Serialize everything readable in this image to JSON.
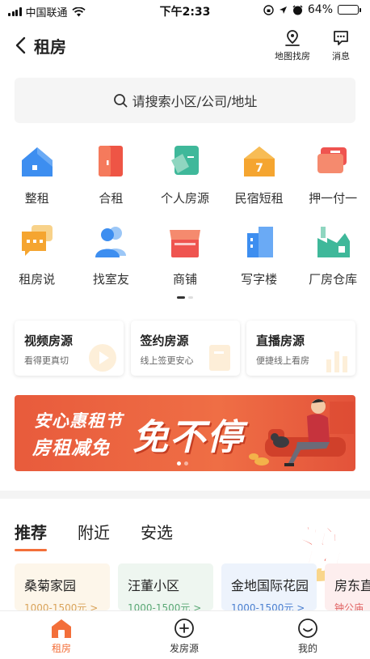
{
  "status_bar": {
    "carrier": "中国联通",
    "time": "下午2:33",
    "battery": "64%",
    "battery_level": 0.64
  },
  "header": {
    "title": "租房",
    "actions": [
      {
        "label": "地图找房",
        "icon": "map-pin-icon"
      },
      {
        "label": "消息",
        "icon": "message-icon"
      }
    ]
  },
  "search": {
    "placeholder": "请搜索小区/公司/地址"
  },
  "categories": [
    {
      "label": "整租",
      "icon": "house-icon",
      "color": "#3d8ef0"
    },
    {
      "label": "合租",
      "icon": "door-icon",
      "color": "#ee5545"
    },
    {
      "label": "个人房源",
      "icon": "tag-icon",
      "color": "#3fb89a"
    },
    {
      "label": "民宿短租",
      "icon": "homestay-icon",
      "color": "#f5a530"
    },
    {
      "label": "押一付一",
      "icon": "card-icon",
      "color": "#ef5450"
    },
    {
      "label": "租房说",
      "icon": "chat-icon",
      "color": "#f5a530"
    },
    {
      "label": "找室友",
      "icon": "roommate-icon",
      "color": "#3d8ef0"
    },
    {
      "label": "商铺",
      "icon": "shop-icon",
      "color": "#ef5450"
    },
    {
      "label": "写字楼",
      "icon": "office-icon",
      "color": "#3d8ef0"
    },
    {
      "label": "厂房仓库",
      "icon": "factory-icon",
      "color": "#3fb89a"
    }
  ],
  "features": [
    {
      "title": "视频房源",
      "subtitle": "看得更真切"
    },
    {
      "title": "签约房源",
      "subtitle": "线上签更安心"
    },
    {
      "title": "直播房源",
      "subtitle": "便捷线上看房"
    }
  ],
  "banner": {
    "line1": "安心惠租节",
    "line2": "房租减免",
    "headline": "免不停"
  },
  "tabs": [
    {
      "label": "推荐",
      "active": true
    },
    {
      "label": "附近",
      "active": false
    },
    {
      "label": "安选",
      "active": false
    }
  ],
  "promo": {
    "line1": "安心",
    "line2": "惠租"
  },
  "listings": [
    {
      "name": "桑菊家园",
      "price": "1000-1500元 >",
      "bg": "#fdf6ea",
      "price_color": "#d9a35a"
    },
    {
      "name": "汪董小区",
      "price": "1000-1500元 >",
      "bg": "#eef6f0",
      "price_color": "#5aa875"
    },
    {
      "name": "金地国际花园",
      "price": "1000-1500元 >",
      "bg": "#edf3fc",
      "price_color": "#4a7fd0"
    },
    {
      "name": "房东直",
      "price": "钟公庙",
      "bg": "#fdeeee",
      "price_color": "#e06060"
    }
  ],
  "bottom_nav": [
    {
      "label": "租房",
      "icon": "home-icon",
      "active": true
    },
    {
      "label": "发房源",
      "icon": "plus-circle-icon",
      "active": false
    },
    {
      "label": "我的",
      "icon": "smile-icon",
      "active": false
    }
  ],
  "colors": {
    "accent": "#f36f3a"
  }
}
